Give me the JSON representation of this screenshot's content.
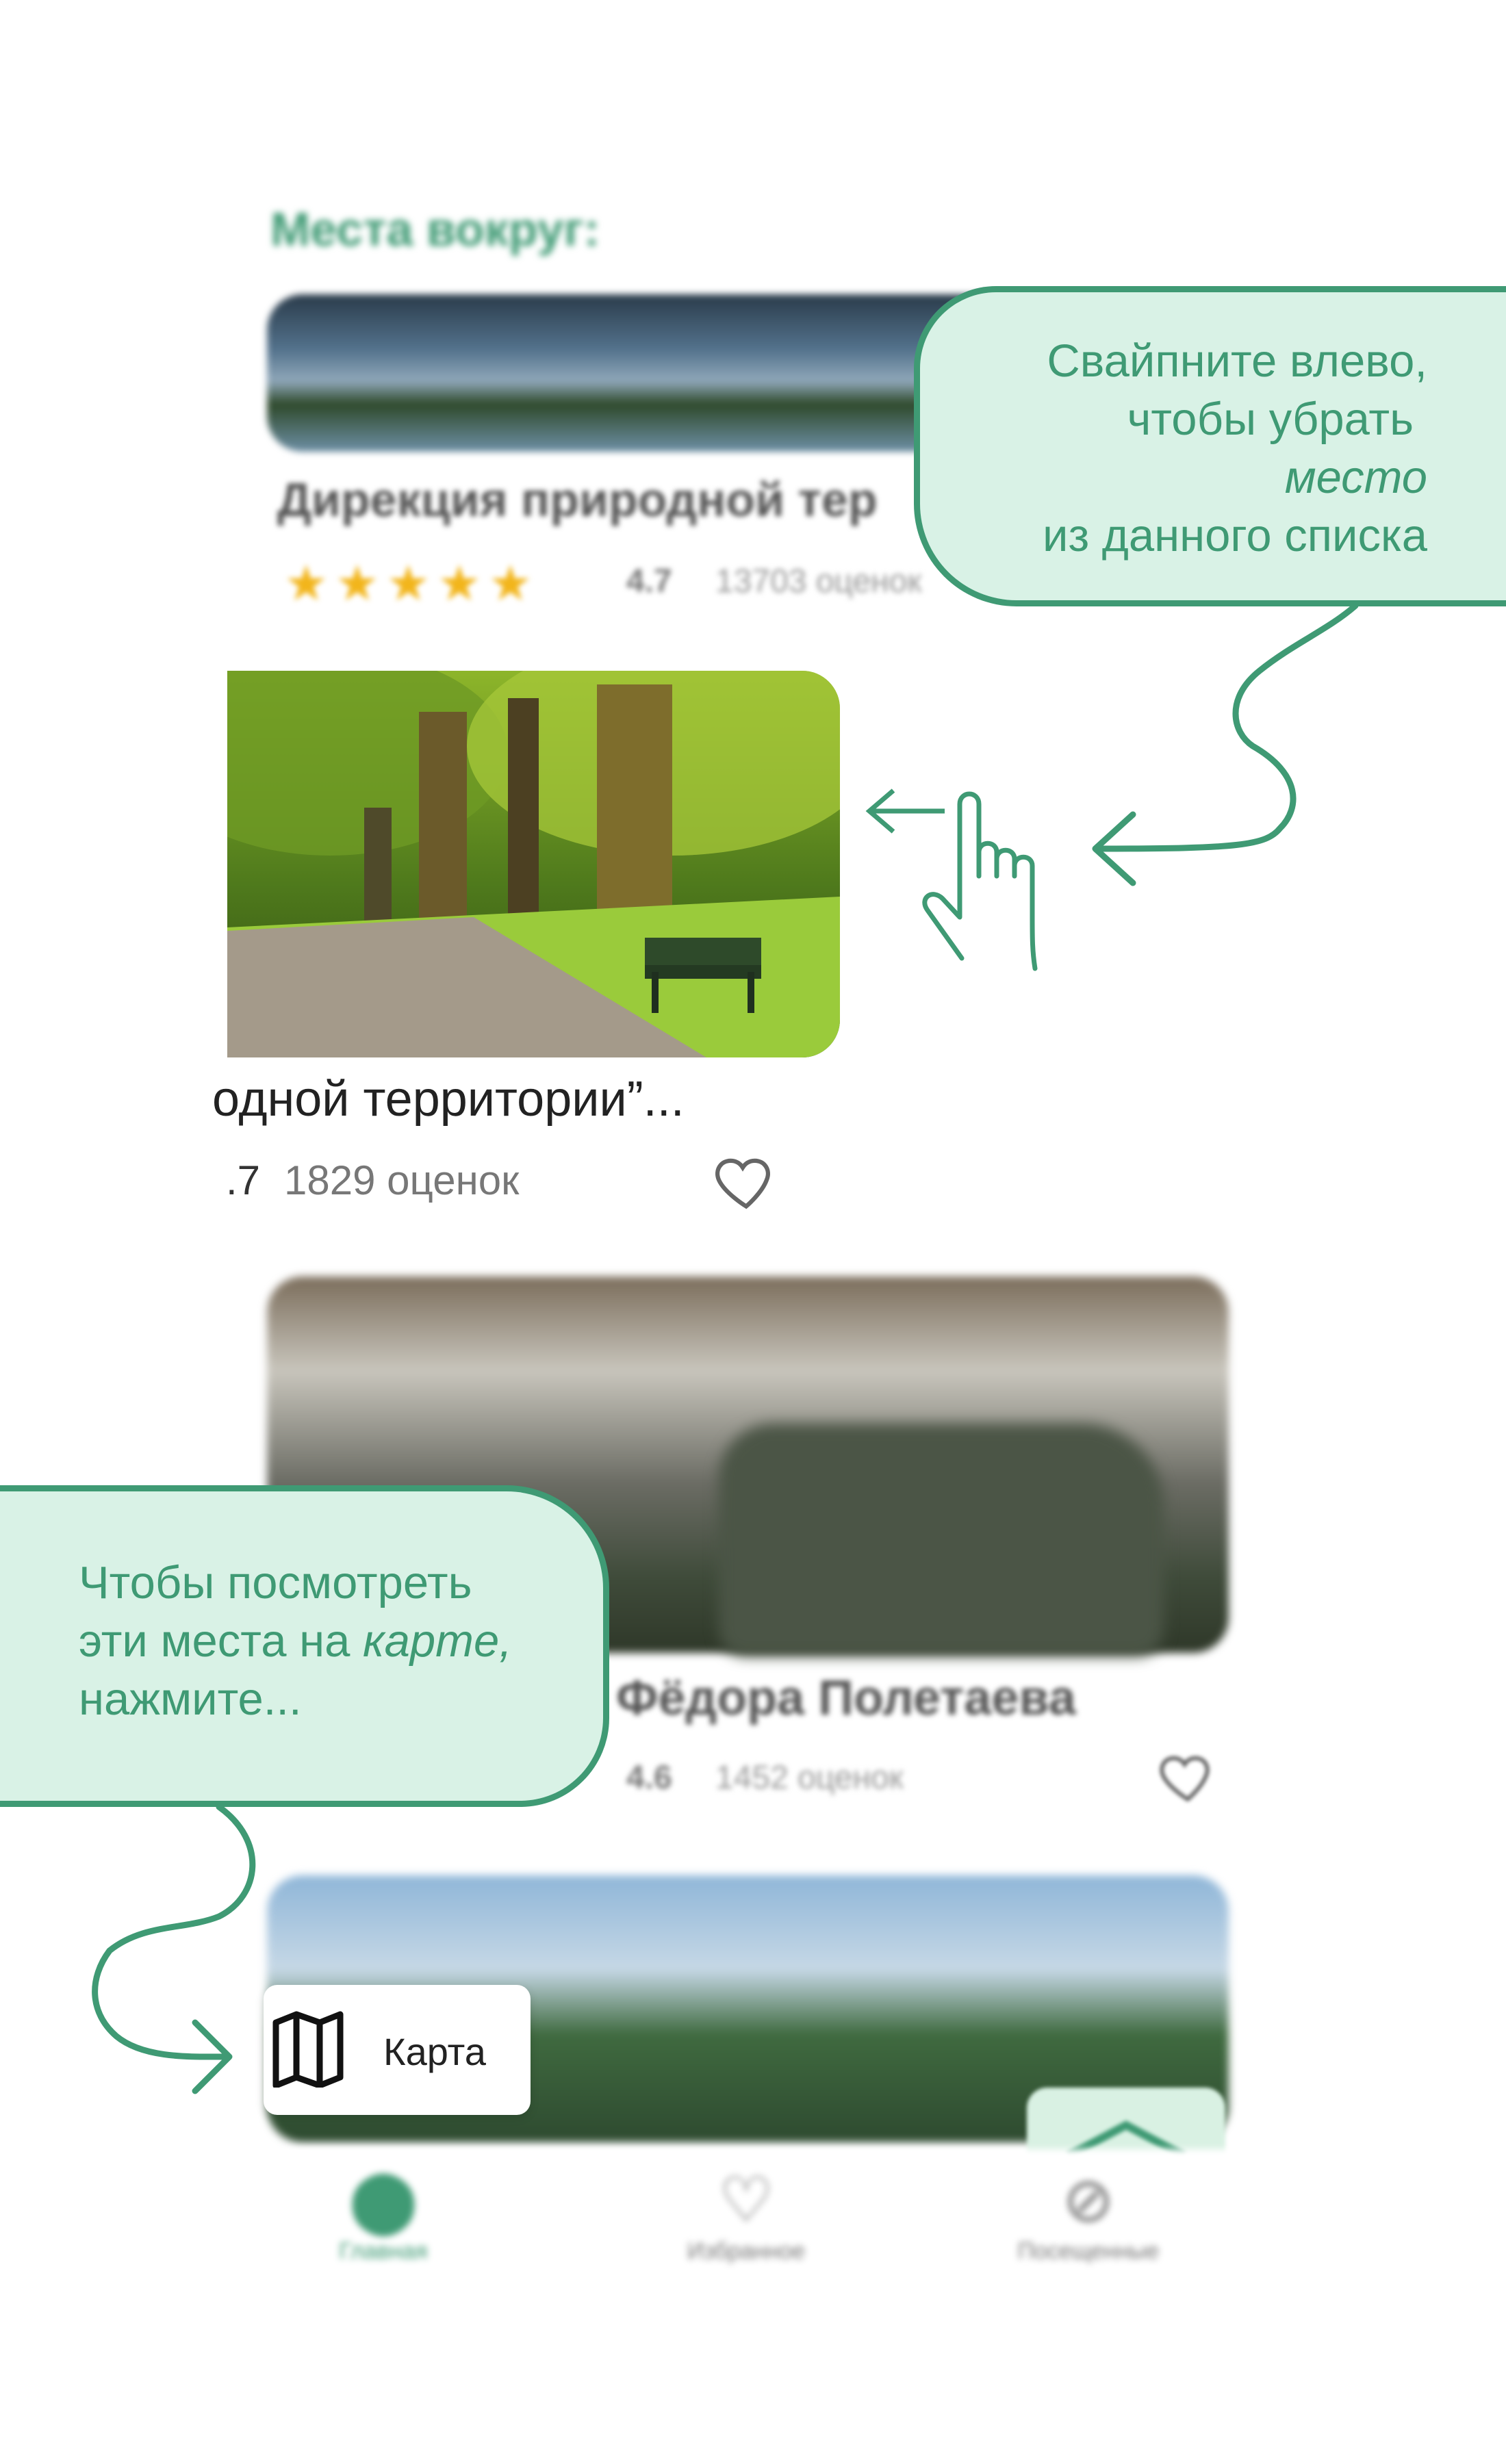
{
  "places_section": {
    "title": "Места вокруг:",
    "cards": [
      {
        "title": "Дирекция природной тер",
        "stars": "★★★★★",
        "rating": "4.7",
        "reviews": "13703 оценок"
      },
      {
        "title": "одной территории”...",
        "rating": ".7",
        "reviews": "1829 оценок"
      },
      {
        "title": "Фёдора Полетаева",
        "rating": "4.6",
        "reviews": "1452 оценок"
      }
    ]
  },
  "callouts": {
    "swipe": {
      "line1": "Свайпните влево,",
      "line2": "чтобы убрать",
      "line3": "место",
      "line4": "из данного списка"
    },
    "map": {
      "line1": "Чтобы посмотреть",
      "line2a": "эти места на ",
      "line2b": "карте,",
      "line3": "нажмите..."
    }
  },
  "map_button": {
    "label": "Карта",
    "icon": "map-icon"
  },
  "bottom_nav": {
    "items": [
      {
        "label": "Главная",
        "icon": "location-pin-icon"
      },
      {
        "label": "Избранное",
        "icon": "heart-icon"
      },
      {
        "label": "Посещенные",
        "icon": "check-circle-icon"
      }
    ]
  },
  "colors": {
    "accent": "#3f9a74",
    "bubble_bg": "#d9f2e6",
    "star": "#f2b51b"
  }
}
